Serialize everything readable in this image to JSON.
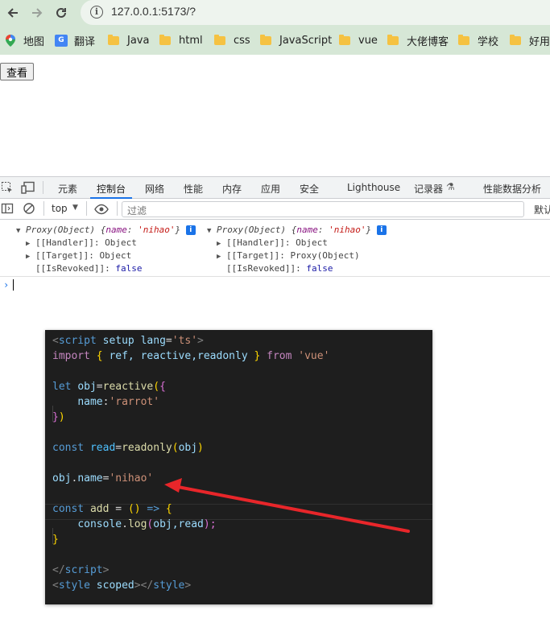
{
  "browser": {
    "url": "127.0.0.1:5173/?",
    "bookmarks": [
      {
        "label": "地图",
        "icon": "map-pin-icon"
      },
      {
        "label": "翻译",
        "icon": "translate-icon"
      },
      {
        "label": "Java",
        "icon": "folder-icon"
      },
      {
        "label": "html",
        "icon": "folder-icon"
      },
      {
        "label": "css",
        "icon": "folder-icon"
      },
      {
        "label": "JavaScript",
        "icon": "folder-icon"
      },
      {
        "label": "vue",
        "icon": "folder-icon"
      },
      {
        "label": "大佬博客",
        "icon": "folder-icon"
      },
      {
        "label": "学校",
        "icon": "folder-icon"
      },
      {
        "label": "好用",
        "icon": "folder-icon"
      }
    ]
  },
  "page": {
    "view_button": "查看"
  },
  "devtools": {
    "tabs": [
      "元素",
      "控制台",
      "网络",
      "性能",
      "内存",
      "应用",
      "安全",
      "Lighthouse",
      "记录器",
      "性能数据分析"
    ],
    "active_tab": "控制台",
    "context": "top",
    "filter_placeholder": "过滤",
    "levels_label": "默认",
    "log": [
      {
        "header_prefix": "Proxy(Object) {",
        "header_key": "name",
        "header_sep": ": ",
        "header_value": "'nihao'",
        "header_suffix": "}",
        "handler": "[[Handler]]: Object",
        "target": "[[Target]]: Object",
        "revoked_key": "[[IsRevoked]]: ",
        "revoked_value": "false"
      },
      {
        "header_prefix": "Proxy(Object) {",
        "header_key": "name",
        "header_sep": ": ",
        "header_value": "'nihao'",
        "header_suffix": "}",
        "handler": "[[Handler]]: Object",
        "target": "[[Target]]: Proxy(Object)",
        "revoked_key": "[[IsRevoked]]: ",
        "revoked_value": "false"
      }
    ]
  },
  "code": {
    "script_open": {
      "lt": "<",
      "tag": "script",
      "sp1": " ",
      "a1": "setup",
      "sp2": " ",
      "a2": "lang",
      "eq": "=",
      "v": "'ts'",
      "gt": ">"
    },
    "import": {
      "kw": "import",
      "ob": " { ",
      "names": "ref, reactive,readonly",
      "cb": " } ",
      "from": "from",
      "sp": " ",
      "mod": "'vue'"
    },
    "let_line": {
      "kw": "let",
      "sp": " ",
      "v": "obj",
      "eq": "=",
      "fn": "reactive",
      "p": "(",
      "b": "{"
    },
    "name_line": {
      "indent": "    ",
      "k": "name",
      "colon": ":",
      "v": "'rarrot'"
    },
    "close_line": {
      "b": "}",
      "p": ")"
    },
    "const_read": {
      "kw": "const",
      "sp": " ",
      "v": "read",
      "eq": "=",
      "fn": "readonly",
      "p1": "(",
      "arg": "obj",
      "p2": ")"
    },
    "assign": {
      "o": "obj",
      "dot": ".",
      "k": "name",
      "eq": "=",
      "v": "'nihao'"
    },
    "const_add": {
      "kw": "const",
      "sp": " ",
      "v": "add",
      "eq": " = ",
      "p": "()",
      "arrow": " => ",
      "b": "{"
    },
    "console_line": {
      "indent": "    ",
      "o": "console",
      "dot": ".",
      "fn": "log",
      "p1": "(",
      "a": "obj,read",
      "p2": ");"
    },
    "add_close": {
      "b": "}"
    },
    "script_close": {
      "lt": "</",
      "tag": "script",
      "gt": ">"
    },
    "style_line": {
      "lt": "<",
      "tag": "style",
      "sp": " ",
      "a": "scoped",
      "gt": "></",
      "tag2": "style",
      "gt2": ">"
    }
  },
  "annotation": {
    "arrow_color": "#e8262a"
  }
}
